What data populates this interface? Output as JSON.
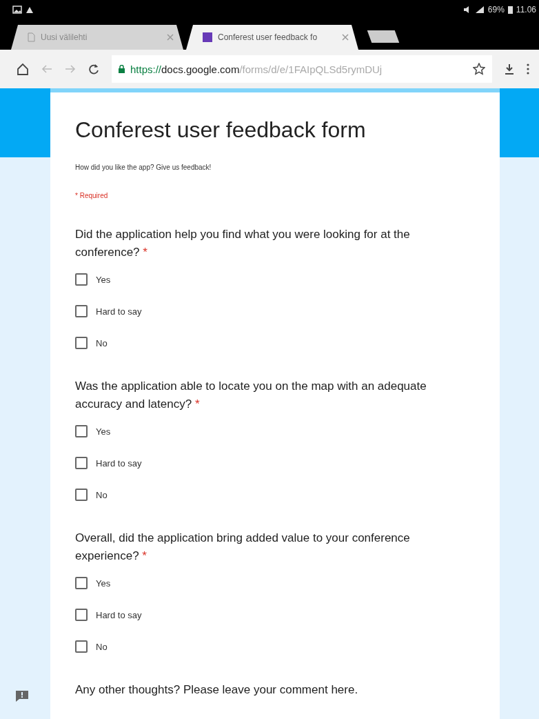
{
  "status_bar": {
    "battery": "69%",
    "time": "11.06"
  },
  "tabs": [
    {
      "title": "Uusi välilehti",
      "selected": false
    },
    {
      "title": "Conferest user feedback fo",
      "selected": true
    }
  ],
  "address_bar": {
    "scheme": "https://",
    "host": "docs.google.com",
    "path": "/forms/d/e/1FAIpQLSd5rymDUj"
  },
  "form": {
    "title": "Conferest user feedback form",
    "description": "How did you like the app? Give us feedback!",
    "required_note": "* Required",
    "questions": [
      {
        "text": "Did the application help you find what you were looking for at the conference?",
        "required_mark": "*",
        "options": [
          {
            "label": "Yes",
            "checked": false
          },
          {
            "label": "Hard to say",
            "checked": false
          },
          {
            "label": "No",
            "checked": false
          }
        ]
      },
      {
        "text": "Was the application able to locate you on the map with an adequate accuracy and latency?",
        "required_mark": "*",
        "options": [
          {
            "label": "Yes",
            "checked": false
          },
          {
            "label": "Hard to say",
            "checked": false
          },
          {
            "label": "No",
            "checked": false
          }
        ]
      },
      {
        "text": "Overall, did the application bring added value to your conference experience?",
        "required_mark": "*",
        "options": [
          {
            "label": "Yes",
            "checked": false
          },
          {
            "label": "Hard to say",
            "checked": false
          },
          {
            "label": "No",
            "checked": false
          }
        ]
      },
      {
        "text": "Any other thoughts? Please leave your comment here."
      }
    ]
  }
}
